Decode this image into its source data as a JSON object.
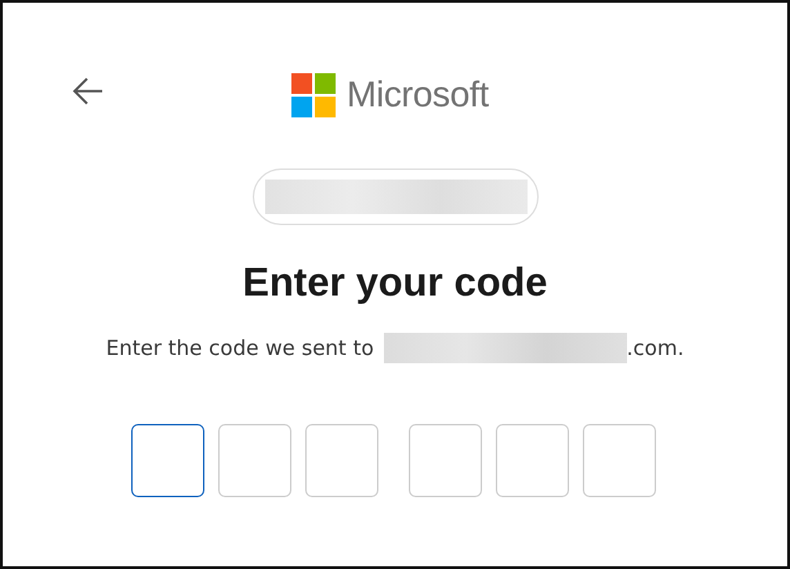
{
  "header": {
    "brand": "Microsoft"
  },
  "heading": "Enter your code",
  "message": {
    "lead": "Enter the code we sent to",
    "tail": ".com."
  },
  "code_boxes": [
    {
      "selected": true
    },
    {
      "selected": false
    },
    {
      "selected": false
    },
    {
      "selected": false
    },
    {
      "selected": false
    },
    {
      "selected": false
    }
  ]
}
